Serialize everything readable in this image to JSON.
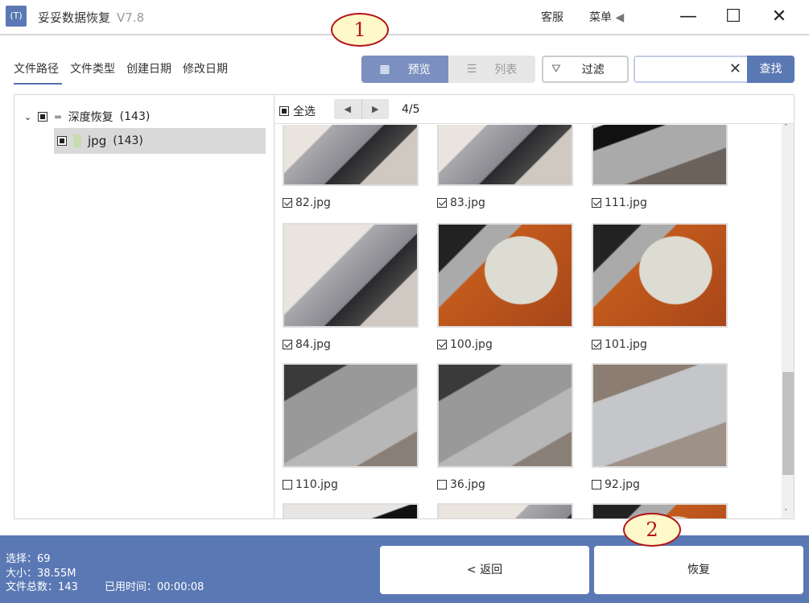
{
  "app": {
    "logo_text": "T",
    "title": "妥妥数据恢复",
    "version": "V7.8",
    "support": "客服",
    "menu": "菜单"
  },
  "tabs": [
    "文件路径",
    "文件类型",
    "创建日期",
    "修改日期"
  ],
  "view": {
    "preview": "预览",
    "list": "列表",
    "filter": "过滤",
    "search_value": "",
    "search_button": "查找"
  },
  "tree": {
    "root": {
      "label": "深度恢复",
      "count": "(143)"
    },
    "child": {
      "label": "jpg",
      "count": "(143)"
    }
  },
  "content": {
    "select_all": "全选",
    "page": "4/5",
    "files": [
      {
        "name": "82.jpg",
        "checked": true
      },
      {
        "name": "83.jpg",
        "checked": true
      },
      {
        "name": "111.jpg",
        "checked": true
      },
      {
        "name": "84.jpg",
        "checked": true
      },
      {
        "name": "100.jpg",
        "checked": true
      },
      {
        "name": "101.jpg",
        "checked": true
      },
      {
        "name": "110.jpg",
        "checked": false
      },
      {
        "name": "36.jpg",
        "checked": false
      },
      {
        "name": "92.jpg",
        "checked": false
      }
    ]
  },
  "footer": {
    "selected": "选择：69",
    "size": "大小：38.55M",
    "total": "文件总数：143",
    "elapsed": "已用时间：00:00:08",
    "back": "< 返回",
    "recover": "恢复"
  },
  "callouts": [
    "1",
    "2"
  ],
  "colors": {
    "accent": "#5a78b4",
    "callout_border": "#b3141a",
    "callout_fill": "#fff8c8"
  }
}
